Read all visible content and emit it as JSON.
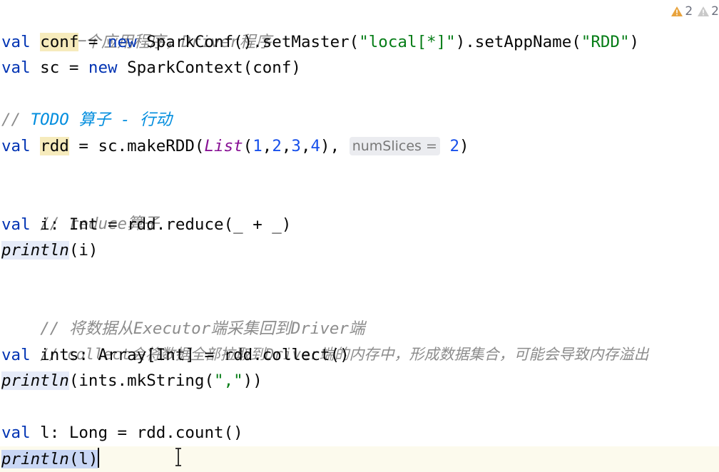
{
  "inspections": {
    "warnings_count": "2",
    "weak_warnings_count": "2"
  },
  "code": {
    "l1_comment": "// 一个应用程序，Driver程序",
    "l2": {
      "val": "val",
      "name": "conf",
      "eq": " = ",
      "new": "new",
      "call1": " SparkConf().setMaster(",
      "master": "\"local[*]\"",
      "call2": ").setAppName(",
      "app": "\"RDD\"",
      "end": ")"
    },
    "l3": {
      "val": "val",
      "rest1": " sc = ",
      "new": "new",
      "rest2": " SparkContext(conf)"
    },
    "l4_comment_prefix": "// ",
    "l4_todo": "TODO 算子 - 行动",
    "l5": {
      "val": "val",
      "name": "rdd",
      "rest": " = sc.makeRDD(",
      "list": "List",
      "open": "(",
      "n1": "1",
      "n2": "2",
      "n3": "3",
      "n4": "4",
      "close": "),",
      "hint": "numSlices =",
      "slices": "2",
      "end": ")"
    },
    "l6_comment": "// reduce算子",
    "l7": {
      "val": "val",
      "rest": " i: Int = rdd.reduce(_ + _)"
    },
    "l8": {
      "fn": "println",
      "rest": "(i)"
    },
    "l9_comment": "// 将数据从Executor端采集回到Driver端",
    "l10_comment": "// collect会将数据全部拉取到Driver端的内存中，形成数据集合，可能会导致内存溢出",
    "l11": {
      "val": "val",
      "rest": " ints: Array[Int] = rdd.collect()"
    },
    "l12": {
      "fn": "println",
      "rest1": "(ints.mkString(",
      "sep": "\",\"",
      "rest2": "))"
    },
    "l13": {
      "val": "val",
      "rest": " l: Long = rdd.count()"
    },
    "l14": {
      "fn": "println",
      "rest": "(l)"
    }
  },
  "colors": {
    "keyword": "#0033b3",
    "string": "#067d17",
    "number": "#1750eb",
    "comment": "#8c8c8c",
    "todo": "#008dde",
    "warning": "#e8a33d"
  }
}
